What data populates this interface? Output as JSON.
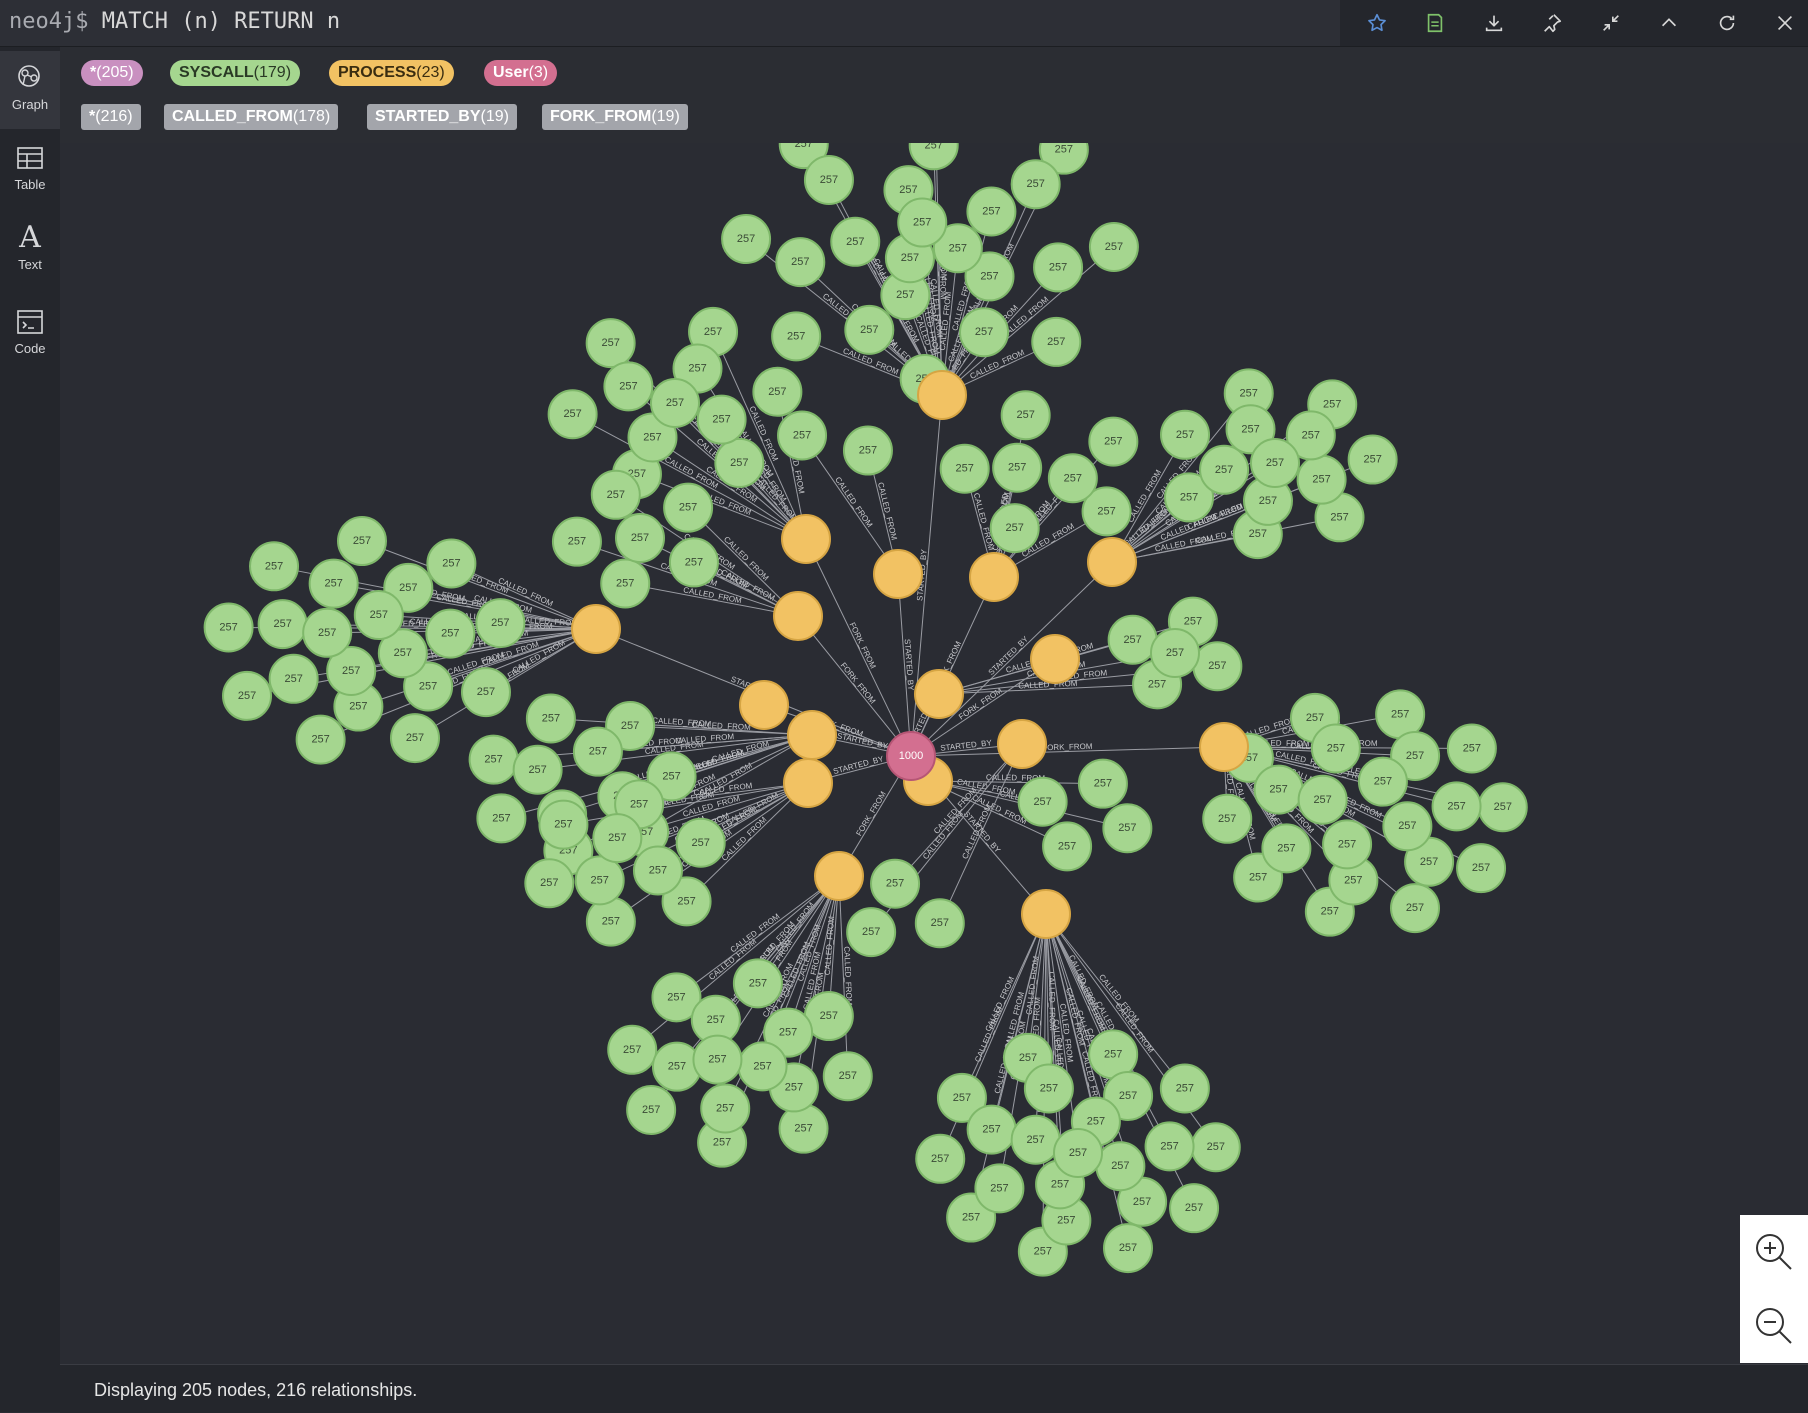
{
  "editor": {
    "prompt": "neo4j$",
    "query": "MATCH (n) RETURN n"
  },
  "toolbar": {
    "buttons": [
      {
        "name": "favorite",
        "icon": "star-icon"
      },
      {
        "name": "save",
        "icon": "save-icon"
      },
      {
        "name": "download",
        "icon": "download-icon"
      },
      {
        "name": "pin",
        "icon": "pin-icon"
      },
      {
        "name": "collapse",
        "icon": "collapse-icon"
      },
      {
        "name": "up",
        "icon": "chevron-up-icon"
      },
      {
        "name": "rerun",
        "icon": "refresh-icon"
      },
      {
        "name": "close",
        "icon": "close-icon"
      }
    ]
  },
  "sidebar": {
    "items": [
      {
        "label": "Graph",
        "icon": "graph-icon",
        "active": true
      },
      {
        "label": "Table",
        "icon": "table-icon"
      },
      {
        "label": "Text",
        "icon": "text-icon",
        "glyph": "A"
      },
      {
        "label": "Code",
        "icon": "code-icon"
      }
    ]
  },
  "legend": {
    "labels": [
      {
        "name": "*",
        "count": "(205)",
        "bg": "#c990c0",
        "fg": "#ffffff"
      },
      {
        "name": "SYSCALL",
        "count": "(179)",
        "bg": "#a5d68f",
        "fg": "#2a3a25"
      },
      {
        "name": "PROCESS",
        "count": "(23)",
        "bg": "#f2c263",
        "fg": "#3a2d10"
      },
      {
        "name": "User",
        "count": "(3)",
        "bg": "#d36f90",
        "fg": "#ffffff"
      }
    ],
    "relationships": [
      {
        "name": "*",
        "count": "(216)"
      },
      {
        "name": "CALLED_FROM",
        "count": "(178)"
      },
      {
        "name": "STARTED_BY",
        "count": "(19)"
      },
      {
        "name": "FORK_FROM",
        "count": "(19)"
      }
    ]
  },
  "graph": {
    "syscall_label": "257",
    "user_label": "1000",
    "rel_called_from": "CALLED_FROM",
    "rel_started_by": "STARTED_BY",
    "rel_fork_from": "FORK_FROM",
    "colors": {
      "syscall_fill": "#a5d68f",
      "syscall_stroke": "#7fb86a",
      "process_fill": "#f2c263",
      "process_stroke": "#d6a543",
      "user_fill": "#d36f90",
      "user_stroke": "#b65675",
      "edge": "#9a9ca3"
    }
  },
  "zoom": {
    "in_icon": "zoom-in-icon",
    "out_icon": "zoom-out-icon"
  },
  "status": {
    "text": "Displaying 205 nodes, 216 relationships."
  }
}
